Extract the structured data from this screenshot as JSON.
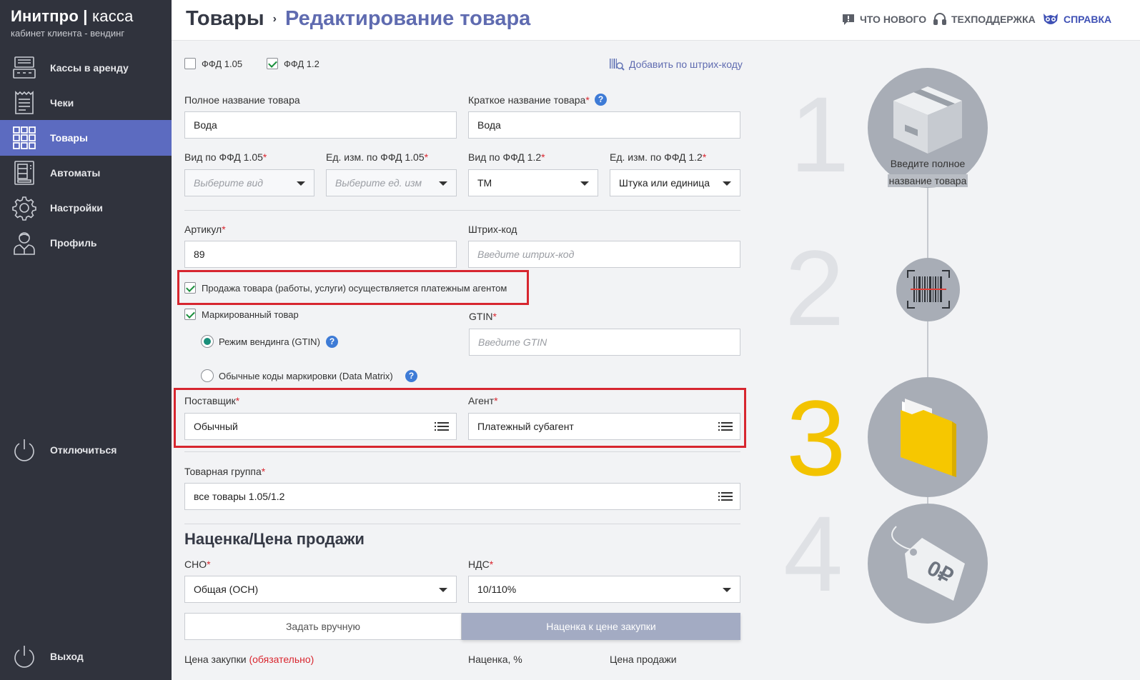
{
  "brand": {
    "name": "Инитпро",
    "sep": "|",
    "product": "касса",
    "subtitle": "кабинет клиента - вендинг"
  },
  "sidebar": {
    "items": [
      {
        "label": "Кассы в аренду",
        "icon": "cash-register-icon"
      },
      {
        "label": "Чеки",
        "icon": "receipt-icon"
      },
      {
        "label": "Товары",
        "icon": "grid-icon",
        "active": true
      },
      {
        "label": "Автоматы",
        "icon": "vending-machine-icon"
      },
      {
        "label": "Настройки",
        "icon": "gear-icon"
      },
      {
        "label": "Профиль",
        "icon": "user-icon"
      }
    ],
    "disconnect": "Отключиться",
    "logout": "Выход"
  },
  "header": {
    "crumb_root": "Товары",
    "crumb_sep": "›",
    "crumb_current": "Редактирование товара",
    "links": {
      "whats_new": "ЧТО НОВОГО",
      "support": "ТЕХПОДДЕРЖКА",
      "help": "СПРАВКА"
    }
  },
  "form": {
    "ffd105_label": "ФФД 1.05",
    "ffd105_checked": false,
    "ffd12_label": "ФФД 1.2",
    "ffd12_checked": true,
    "add_by_barcode": "Добавить по штрих-коду",
    "full_name_label": "Полное название товара",
    "full_name_value": "Вода",
    "short_name_label": "Краткое название товара",
    "short_name_value": "Вода",
    "kind105_label": "Вид по ФФД 1.05",
    "kind105_placeholder": "Выберите вид",
    "unit105_label": "Ед. изм. по ФФД 1.05",
    "unit105_placeholder": "Выберите ед. изм",
    "kind12_label": "Вид по ФФД 1.2",
    "kind12_value": "ТМ",
    "unit12_label": "Ед. изм. по ФФД 1.2",
    "unit12_value": "Штука или единица",
    "article_label": "Артикул",
    "article_value": "89",
    "barcode_label": "Штрих-код",
    "barcode_placeholder": "Введите штрих-код",
    "agent_sale_label": "Продажа товара (работы, услуги) осуществляется платежным агентом",
    "agent_sale_checked": true,
    "marked_label": "Маркированный товар",
    "marked_checked": true,
    "vending_mode_label": "Режим вендинга (GTIN)",
    "vending_mode_selected": true,
    "datamatrix_label": "Обычные коды маркировки (Data Matrix)",
    "gtin_label": "GTIN",
    "gtin_placeholder": "Введите GTIN",
    "supplier_label": "Поставщик",
    "supplier_value": "Обычный",
    "agent_label": "Агент",
    "agent_value": "Платежный субагент",
    "group_label": "Товарная группа",
    "group_value": "все товары 1.05/1.2",
    "pricing_title": "Наценка/Цена продажи",
    "sno_label": "СНО",
    "sno_value": "Общая (ОСН)",
    "nds_label": "НДС",
    "nds_value": "10/110%",
    "toggle_manual": "Задать вручную",
    "toggle_markup": "Наценка к цене закупки",
    "toggle_active": "markup",
    "purchase_price_label": "Цена закупки",
    "purchase_price_required": "(обязательно)",
    "markup_label": "Наценка, %",
    "sale_price_label": "Цена продажи",
    "required_mark": "*"
  },
  "steps": {
    "items": [
      {
        "number": "1",
        "icon": "box-icon",
        "caption_line1": "Введите полное",
        "caption_line2": "название товара"
      },
      {
        "number": "2",
        "icon": "barcode-icon"
      },
      {
        "number": "3",
        "icon": "folder-icon",
        "active": true
      },
      {
        "number": "4",
        "icon": "price-tag-icon",
        "tag_text": "0₽"
      }
    ],
    "colors": {
      "inactive_number": "#dfe1e5",
      "active_number": "#f3c300",
      "circle": "#a8adb6"
    }
  },
  "colors": {
    "sidebar_bg": "#30333d",
    "accent": "#5c6bc0",
    "highlight_border": "#d7262f",
    "required": "#d9262f"
  }
}
